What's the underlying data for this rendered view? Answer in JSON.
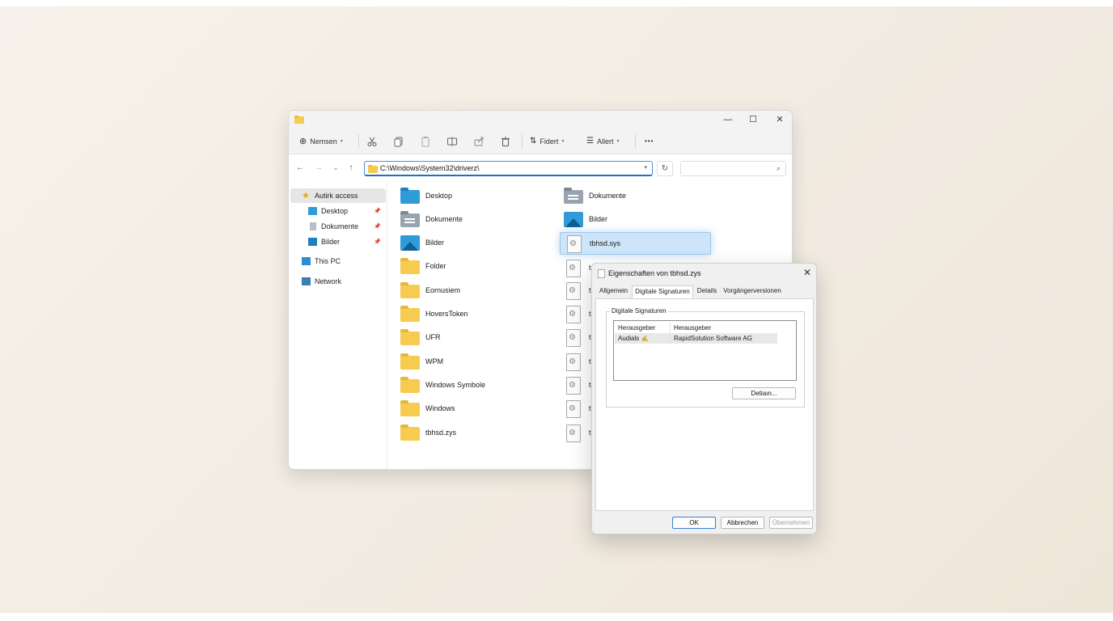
{
  "explorer": {
    "toolbar": {
      "new_label": "Nemsen",
      "sort_label": "Fidert",
      "view_label": "Allert",
      "more_label": "•••"
    },
    "address": {
      "path": "C:\\Windows\\System32\\driverz\\"
    },
    "sidebar": {
      "items": [
        {
          "label": "Autirk access"
        },
        {
          "label": "Desktop"
        },
        {
          "label": "Dokumente"
        },
        {
          "label": "Bilder"
        },
        {
          "label": "This PC"
        },
        {
          "label": "Network"
        }
      ]
    },
    "files_col1": [
      {
        "name": "Desktop",
        "icon": "blue-folder-icon"
      },
      {
        "name": "Dokumente",
        "icon": "documents-folder-icon"
      },
      {
        "name": "Bilder",
        "icon": "pictures-folder-icon"
      },
      {
        "name": "Folder",
        "icon": "folder-icon"
      },
      {
        "name": "Eornusiem",
        "icon": "folder-icon"
      },
      {
        "name": "HoversToken",
        "icon": "folder-icon"
      },
      {
        "name": "UFR",
        "icon": "folder-icon"
      },
      {
        "name": "WPM",
        "icon": "folder-icon"
      },
      {
        "name": "Windows Symbole",
        "icon": "folder-icon"
      },
      {
        "name": "Windows",
        "icon": "folder-icon"
      },
      {
        "name": "tbhsd.zys",
        "icon": "folder-icon"
      }
    ],
    "files_col2": [
      {
        "name": "Dokumente",
        "icon": "documents-folder-icon"
      },
      {
        "name": "Bilder",
        "icon": "pictures-folder-icon"
      },
      {
        "name": "tbhsd.sys",
        "icon": "system-file-icon"
      },
      {
        "name": "t",
        "icon": "system-file-icon"
      },
      {
        "name": "t",
        "icon": "system-file-icon"
      },
      {
        "name": "t",
        "icon": "system-file-icon"
      },
      {
        "name": "t",
        "icon": "system-file-icon"
      },
      {
        "name": "t",
        "icon": "system-file-icon"
      },
      {
        "name": "t",
        "icon": "system-file-icon"
      },
      {
        "name": "t",
        "icon": "system-file-icon"
      },
      {
        "name": "t",
        "icon": "system-file-icon"
      }
    ]
  },
  "properties": {
    "title": "Eigenschaften von tbhsd.zys",
    "tabs": [
      "Allgemein",
      "Digitale Signaturen",
      "Details",
      "Vorgängerversionen"
    ],
    "group_label": "Digitale Signaturen",
    "header": {
      "col1": "Herausgeber",
      "col2": "Herausgeber"
    },
    "row": {
      "col1": "Audials",
      "col2": "RapidSolution Software AG"
    },
    "details_button": "Detiaın...",
    "ok_button": "OK",
    "cancel_button": "Abbrechen",
    "apply_button": "Übernehmen"
  },
  "colors": {
    "accent": "#1f6fd0",
    "selection": "#cde5f8",
    "folder": "#f7cb4f"
  }
}
